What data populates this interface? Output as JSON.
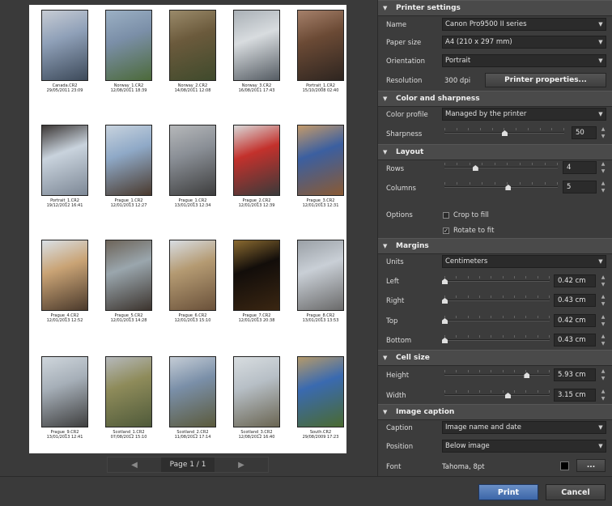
{
  "preview": {
    "page_label": "Page 1 / 1",
    "prev_icon": "triangle-left-icon",
    "next_icon": "triangle-right-icon",
    "images": [
      {
        "name": "Canada.CR2",
        "date": "29/05/2011 23:09",
        "colors": [
          "#8fa0b8",
          "#3d4a5a",
          "#c7ccd4"
        ]
      },
      {
        "name": "Norway_1.CR2",
        "date": "12/08/2011 18:39",
        "colors": [
          "#7b8fa8",
          "#4c6a3a",
          "#9bb0c4"
        ]
      },
      {
        "name": "Norway_2.CR2",
        "date": "14/08/2011 12:08",
        "colors": [
          "#6b5a3c",
          "#3f4a2c",
          "#9a8a6a"
        ]
      },
      {
        "name": "Norway_3.CR2",
        "date": "16/08/2011 17:43",
        "colors": [
          "#d8dcdf",
          "#555c63",
          "#a9b0b6"
        ]
      },
      {
        "name": "Portrait_1.CR2",
        "date": "15/10/2008 02:40",
        "colors": [
          "#6b4a35",
          "#2e2520",
          "#a5806a"
        ]
      },
      {
        "name": "Portrait_1.CR2",
        "date": "19/12/2012 16:41",
        "colors": [
          "#c9d3dd",
          "#7d8896",
          "#3b3634"
        ]
      },
      {
        "name": "Prague_1.CR2",
        "date": "12/01/2013 12:27",
        "colors": [
          "#8fa9c7",
          "#4a3a2e",
          "#c8d3de"
        ]
      },
      {
        "name": "Prague_1.CR2",
        "date": "13/01/2013 12:34",
        "colors": [
          "#8a8f96",
          "#3e3e3e",
          "#b6b8ba"
        ]
      },
      {
        "name": "Prague_2.CR2",
        "date": "12/01/2013 12:39",
        "colors": [
          "#c3312c",
          "#3a3a3a",
          "#d9d9d9"
        ]
      },
      {
        "name": "Prague_3.CR2",
        "date": "12/01/2013 12:31",
        "colors": [
          "#3b5fa0",
          "#8a5a33",
          "#c49a6a"
        ]
      },
      {
        "name": "Prague_4.CR2",
        "date": "12/01/2013 12:52",
        "colors": [
          "#c9a375",
          "#4b3a2c",
          "#d9e0e6"
        ]
      },
      {
        "name": "Prague_5.CR2",
        "date": "12/01/2013 14:28",
        "colors": [
          "#9aa6ad",
          "#3c342e",
          "#6d6459"
        ]
      },
      {
        "name": "Prague_6.CR2",
        "date": "12/01/2013 15:10",
        "colors": [
          "#b49a72",
          "#6a513a",
          "#d8dde3"
        ]
      },
      {
        "name": "Prague_7.CR2",
        "date": "12/01/2013 20:38",
        "colors": [
          "#120d0a",
          "#3a2612",
          "#8a6a30"
        ]
      },
      {
        "name": "Prague_8.CR2",
        "date": "13/01/2013 13:53",
        "colors": [
          "#c9cfd6",
          "#6a6a6a",
          "#9aa0a6"
        ]
      },
      {
        "name": "Prague_9.CR2",
        "date": "13/01/2013 12:41",
        "colors": [
          "#a6afb8",
          "#3f3f3f",
          "#cfd6dc"
        ]
      },
      {
        "name": "Scotland_1.CR2",
        "date": "07/08/2012 15:10",
        "colors": [
          "#8e8b5a",
          "#4f5a3a",
          "#b6b9bc"
        ]
      },
      {
        "name": "Scotland_2.CR2",
        "date": "11/08/2012 17:14",
        "colors": [
          "#7a8fa8",
          "#5b5a3c",
          "#c5cdd6"
        ]
      },
      {
        "name": "Scotland_3.CR2",
        "date": "12/08/2012 16:40",
        "colors": [
          "#b7bfc6",
          "#6a6552",
          "#d8dde0"
        ]
      },
      {
        "name": "South.CR2",
        "date": "29/08/2009 17:23",
        "colors": [
          "#3a6ab0",
          "#4a6a30",
          "#b59a6a"
        ]
      }
    ]
  },
  "panel": {
    "printer_settings": {
      "header": "Printer settings",
      "name_label": "Name",
      "name_value": "Canon Pro9500 II series",
      "paper_label": "Paper size",
      "paper_value": "A4 (210 x 297 mm)",
      "orientation_label": "Orientation",
      "orientation_value": "Portrait",
      "resolution_label": "Resolution",
      "resolution_value": "300 dpi",
      "properties_button": "Printer properties..."
    },
    "color": {
      "header": "Color and sharpness",
      "profile_label": "Color profile",
      "profile_value": "Managed by the printer",
      "sharpness_label": "Sharpness",
      "sharpness_value": "50",
      "sharpness_fraction": 0.5
    },
    "layout": {
      "header": "Layout",
      "rows_label": "Rows",
      "rows_value": "4",
      "rows_fraction": 0.27,
      "columns_label": "Columns",
      "columns_value": "5",
      "columns_fraction": 0.56,
      "options_label": "Options",
      "crop_label": "Crop to fill",
      "crop_checked": false,
      "rotate_label": "Rotate to fit",
      "rotate_checked": true
    },
    "margins": {
      "header": "Margins",
      "units_label": "Units",
      "units_value": "Centimeters",
      "left_label": "Left",
      "left_value": "0.42 cm",
      "right_label": "Right",
      "right_value": "0.43 cm",
      "top_label": "Top",
      "top_value": "0.42 cm",
      "bottom_label": "Bottom",
      "bottom_value": "0.43 cm"
    },
    "cell_size": {
      "header": "Cell size",
      "height_label": "Height",
      "height_value": "5.93 cm",
      "height_fraction": 0.78,
      "width_label": "Width",
      "width_value": "3.15 cm",
      "width_fraction": 0.6
    },
    "caption": {
      "header": "Image caption",
      "caption_label": "Caption",
      "caption_value": "Image name and date",
      "position_label": "Position",
      "position_value": "Below image",
      "font_label": "Font",
      "font_value": "Tahoma, 8pt",
      "font_color": "#000000",
      "more_button": "..."
    }
  },
  "footer": {
    "print_label": "Print",
    "cancel_label": "Cancel"
  },
  "colors": {
    "accent": "#4a72b0",
    "panel_bg": "#3c3c3c",
    "header_bg": "#4a4a4a"
  }
}
